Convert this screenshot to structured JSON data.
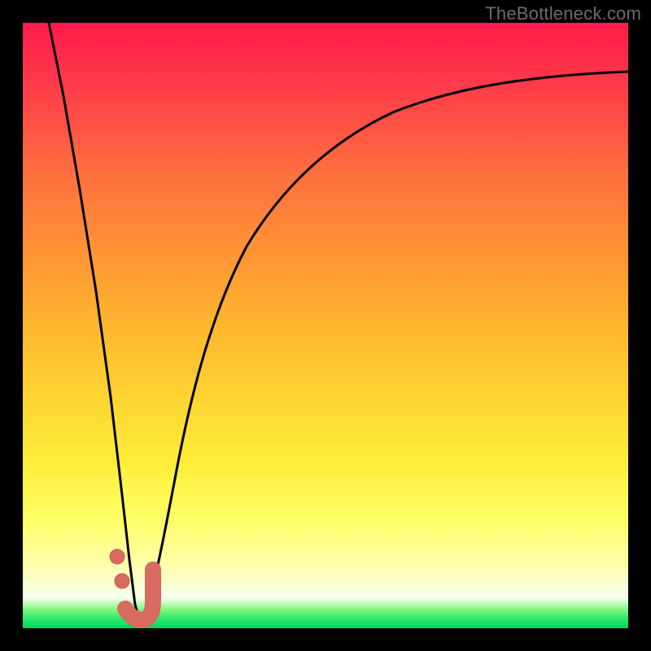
{
  "watermark": "TheBottleneck.com",
  "colors": {
    "frame": "#000000",
    "curve": "#000000",
    "marker_fill": "#d86a5f",
    "marker_stroke": "#c55a50"
  },
  "chart_data": {
    "type": "line",
    "title": "",
    "xlabel": "",
    "ylabel": "",
    "xlim": [
      0,
      100
    ],
    "ylim": [
      0,
      100
    ],
    "grid": false,
    "series": [
      {
        "name": "left-branch",
        "x": [
          4,
          6,
          8,
          10,
          12,
          14,
          15.5,
          17
        ],
        "values": [
          100,
          84,
          68,
          52,
          36,
          20,
          8,
          2
        ]
      },
      {
        "name": "right-branch",
        "x": [
          20,
          22,
          24,
          27,
          30,
          35,
          40,
          50,
          60,
          70,
          80,
          90,
          100
        ],
        "values": [
          3,
          12,
          24,
          38,
          50,
          62,
          70,
          79,
          84,
          87,
          89,
          90.5,
          91.5
        ]
      }
    ],
    "markers": [
      {
        "name": "dot-upper",
        "x": 14.5,
        "y": 11,
        "r": 1.3
      },
      {
        "name": "dot-lower",
        "x": 15.5,
        "y": 7,
        "r": 1.3
      },
      {
        "name": "j-hook",
        "kind": "stroke",
        "x_path": [
          16.3,
          17.2,
          18.2,
          19.2,
          20.0,
          20.3,
          20.3
        ],
        "y_path": [
          2.0,
          1.6,
          1.8,
          2.6,
          4.2,
          6.4,
          8.8
        ],
        "width": 2.8
      }
    ],
    "notes": "Background is a vertical color ramp from red (high bottleneck) through orange/yellow to green (no bottleneck). Two black curves form a V meeting near x≈18; the right branch rises asymptotically. Salmon-colored markers and a J-shaped hook sit near the valley."
  }
}
